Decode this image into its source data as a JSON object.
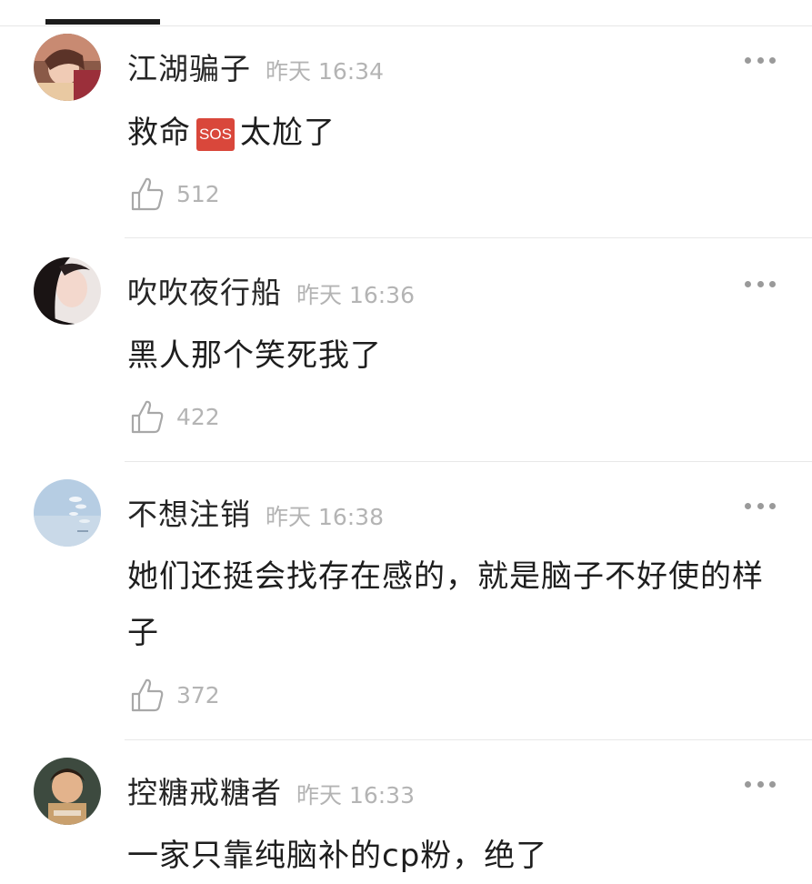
{
  "comments": [
    {
      "author": "江湖骗子",
      "time": "昨天 16:34",
      "content_before": "救命",
      "badge": "SOS",
      "content_after": "太尬了",
      "likes": "512",
      "avatar_icon": "avatar-girl-red-icon"
    },
    {
      "author": "吹吹夜行船",
      "time": "昨天 16:36",
      "content": "黑人那个笑死我了",
      "likes": "422",
      "avatar_icon": "avatar-girl-dark-icon"
    },
    {
      "author": "不想注销",
      "time": "昨天 16:38",
      "content": "她们还挺会找存在感的，就是脑子不好使的样子",
      "likes": "372",
      "avatar_icon": "avatar-sky-icon"
    },
    {
      "author": "控糖戒糖者",
      "time": "昨天 16:33",
      "content": "一家只靠纯脑补的cp粉，绝了",
      "avatar_icon": "avatar-child-icon"
    }
  ],
  "colors": {
    "text": "#1e1e1e",
    "muted": "#b4b4b4",
    "badge": "#d9473b"
  }
}
